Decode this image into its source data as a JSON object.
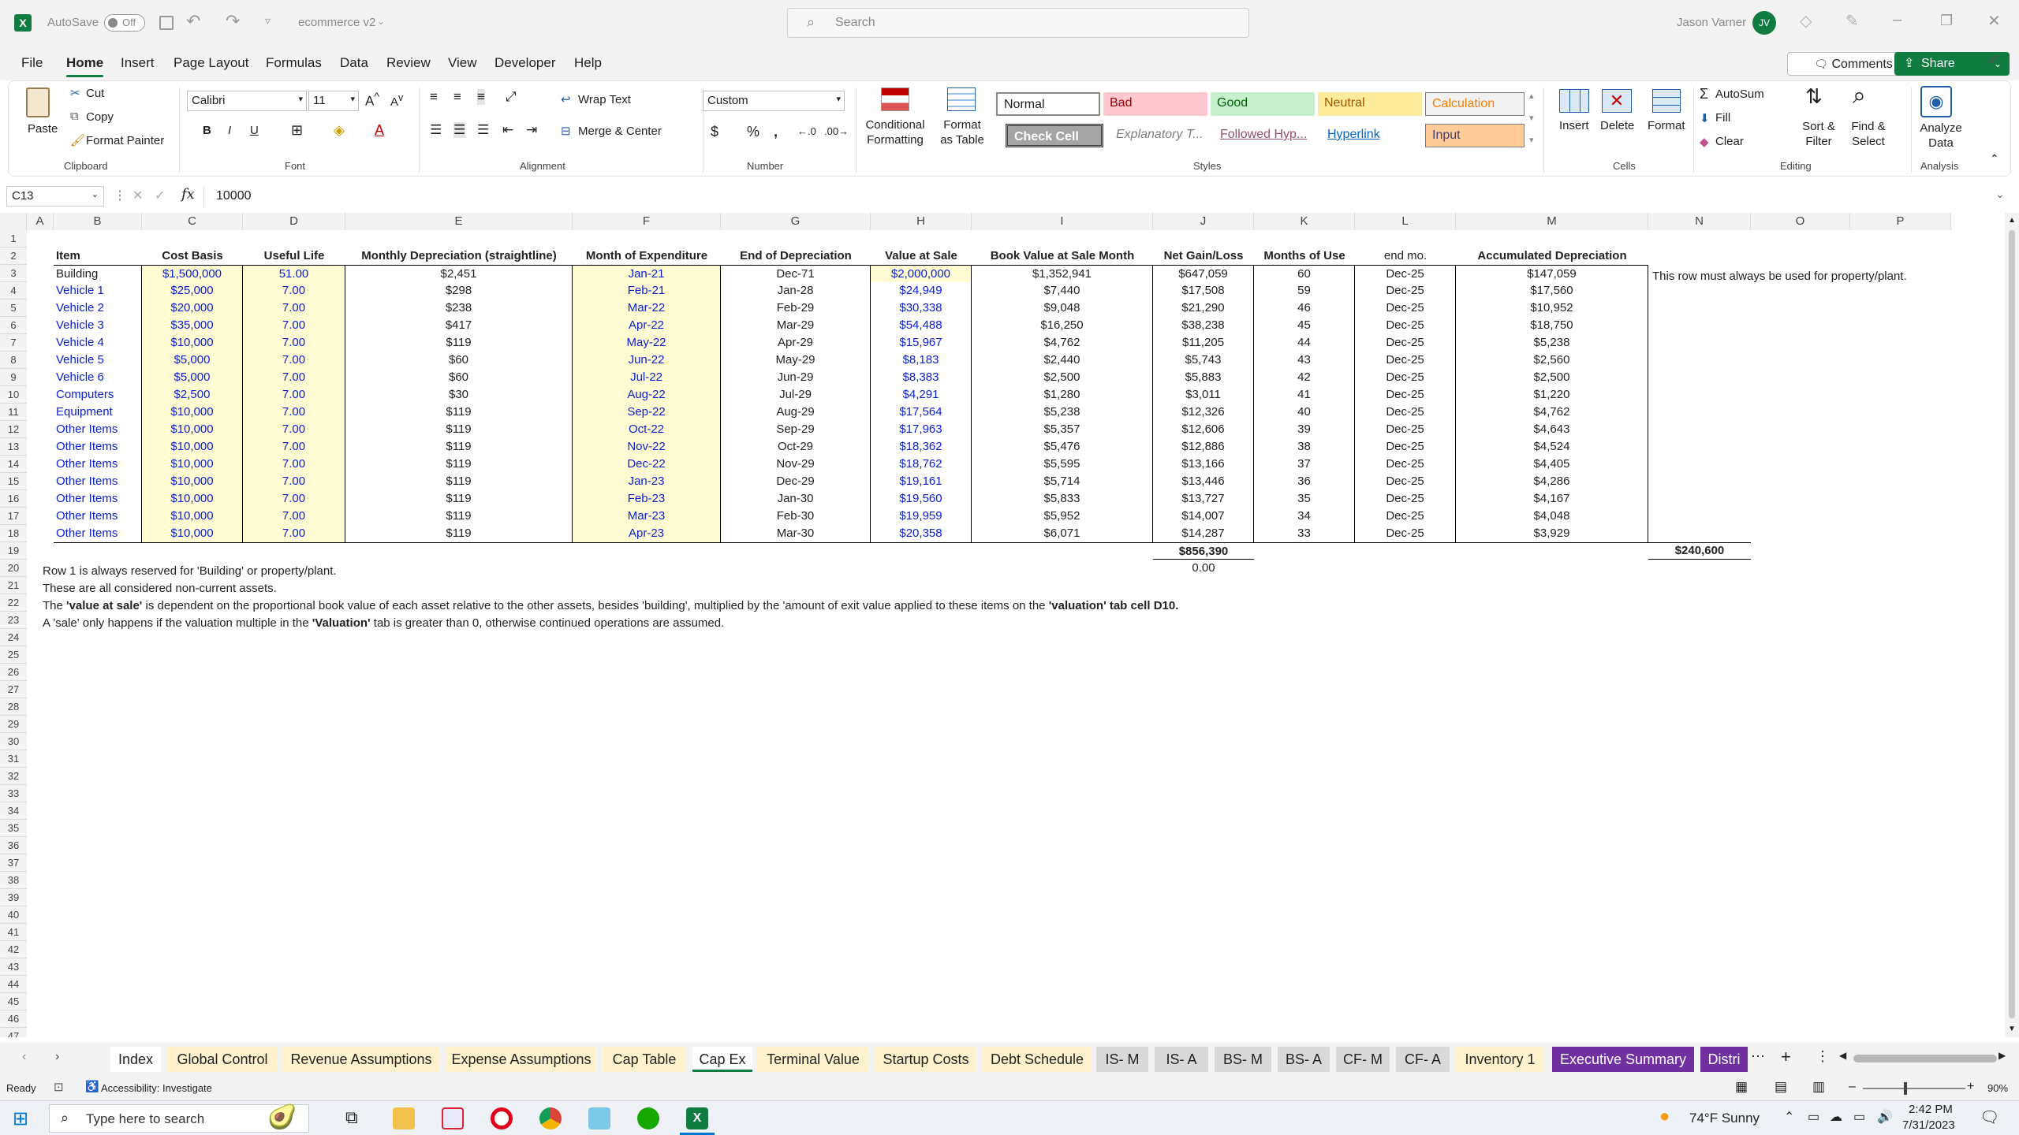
{
  "titlebar": {
    "autosave": "AutoSave",
    "autosave_state": "Off",
    "filename": "ecommerce v2",
    "search_placeholder": "Search",
    "user": "Jason Varner",
    "avatar_initials": "JV"
  },
  "menu": {
    "items": [
      "File",
      "Home",
      "Insert",
      "Page Layout",
      "Formulas",
      "Data",
      "Review",
      "View",
      "Developer",
      "Help"
    ],
    "comments": "Comments",
    "share": "Share"
  },
  "ribbon": {
    "clipboard": {
      "paste": "Paste",
      "cut": "Cut",
      "copy": "Copy",
      "format_painter": "Format Painter",
      "label": "Clipboard"
    },
    "font": {
      "name": "Calibri",
      "size": "11",
      "label": "Font"
    },
    "alignment": {
      "wrap": "Wrap Text",
      "merge": "Merge & Center",
      "label": "Alignment"
    },
    "number": {
      "format": "Custom",
      "label": "Number"
    },
    "styles": {
      "conditional": "Conditional Formatting",
      "format_table": "Format as Table",
      "label": "Styles",
      "cells": [
        "Normal",
        "Bad",
        "Good",
        "Neutral",
        "Calculation",
        "Check Cell",
        "Explanatory T...",
        "Followed Hyp...",
        "Hyperlink",
        "Input"
      ]
    },
    "cells": {
      "insert": "Insert",
      "delete": "Delete",
      "format": "Format",
      "label": "Cells"
    },
    "editing": {
      "autosum": "AutoSum",
      "fill": "Fill",
      "clear": "Clear",
      "sort": "Sort & Filter",
      "find": "Find & Select",
      "label": "Editing"
    },
    "analysis": {
      "analyze": "Analyze Data",
      "label": "Analysis"
    }
  },
  "formula_bar": {
    "name_box": "C13",
    "fx": "fx",
    "value": "10000"
  },
  "columns": [
    "A",
    "B",
    "C",
    "D",
    "E",
    "F",
    "G",
    "H",
    "I",
    "J",
    "K",
    "L",
    "M",
    "N",
    "O",
    "P"
  ],
  "headers": [
    "Item",
    "Cost Basis",
    "Useful Life",
    "Monthly Depreciation (straightline)",
    "Month of Expenditure",
    "End of Depreciation",
    "Value at Sale",
    "Book Value at Sale Month",
    "Net Gain/Loss",
    "Months of Use",
    "end mo.",
    "Accumulated Depreciation"
  ],
  "rows": [
    [
      "Building",
      "$1,500,000",
      "51.00",
      "$2,451",
      "Jan-21",
      "Dec-71",
      "$2,000,000",
      "$1,352,941",
      "$647,059",
      "60",
      "Dec-25",
      "$147,059"
    ],
    [
      "Vehicle 1",
      "$25,000",
      "7.00",
      "$298",
      "Feb-21",
      "Jan-28",
      "$24,949",
      "$7,440",
      "$17,508",
      "59",
      "Dec-25",
      "$17,560"
    ],
    [
      "Vehicle 2",
      "$20,000",
      "7.00",
      "$238",
      "Mar-22",
      "Feb-29",
      "$30,338",
      "$9,048",
      "$21,290",
      "46",
      "Dec-25",
      "$10,952"
    ],
    [
      "Vehicle 3",
      "$35,000",
      "7.00",
      "$417",
      "Apr-22",
      "Mar-29",
      "$54,488",
      "$16,250",
      "$38,238",
      "45",
      "Dec-25",
      "$18,750"
    ],
    [
      "Vehicle 4",
      "$10,000",
      "7.00",
      "$119",
      "May-22",
      "Apr-29",
      "$15,967",
      "$4,762",
      "$11,205",
      "44",
      "Dec-25",
      "$5,238"
    ],
    [
      "Vehicle 5",
      "$5,000",
      "7.00",
      "$60",
      "Jun-22",
      "May-29",
      "$8,183",
      "$2,440",
      "$5,743",
      "43",
      "Dec-25",
      "$2,560"
    ],
    [
      "Vehicle 6",
      "$5,000",
      "7.00",
      "$60",
      "Jul-22",
      "Jun-29",
      "$8,383",
      "$2,500",
      "$5,883",
      "42",
      "Dec-25",
      "$2,500"
    ],
    [
      "Computers",
      "$2,500",
      "7.00",
      "$30",
      "Aug-22",
      "Jul-29",
      "$4,291",
      "$1,280",
      "$3,011",
      "41",
      "Dec-25",
      "$1,220"
    ],
    [
      "Equipment",
      "$10,000",
      "7.00",
      "$119",
      "Sep-22",
      "Aug-29",
      "$17,564",
      "$5,238",
      "$12,326",
      "40",
      "Dec-25",
      "$4,762"
    ],
    [
      "Other Items",
      "$10,000",
      "7.00",
      "$119",
      "Oct-22",
      "Sep-29",
      "$17,963",
      "$5,357",
      "$12,606",
      "39",
      "Dec-25",
      "$4,643"
    ],
    [
      "Other Items",
      "$10,000",
      "7.00",
      "$119",
      "Nov-22",
      "Oct-29",
      "$18,362",
      "$5,476",
      "$12,886",
      "38",
      "Dec-25",
      "$4,524"
    ],
    [
      "Other Items",
      "$10,000",
      "7.00",
      "$119",
      "Dec-22",
      "Nov-29",
      "$18,762",
      "$5,595",
      "$13,166",
      "37",
      "Dec-25",
      "$4,405"
    ],
    [
      "Other Items",
      "$10,000",
      "7.00",
      "$119",
      "Jan-23",
      "Dec-29",
      "$19,161",
      "$5,714",
      "$13,446",
      "36",
      "Dec-25",
      "$4,286"
    ],
    [
      "Other Items",
      "$10,000",
      "7.00",
      "$119",
      "Feb-23",
      "Jan-30",
      "$19,560",
      "$5,833",
      "$13,727",
      "35",
      "Dec-25",
      "$4,167"
    ],
    [
      "Other Items",
      "$10,000",
      "7.00",
      "$119",
      "Mar-23",
      "Feb-30",
      "$19,959",
      "$5,952",
      "$14,007",
      "34",
      "Dec-25",
      "$4,048"
    ],
    [
      "Other Items",
      "$10,000",
      "7.00",
      "$119",
      "Apr-23",
      "Mar-30",
      "$20,358",
      "$6,071",
      "$14,287",
      "33",
      "Dec-25",
      "$3,929"
    ]
  ],
  "totals": {
    "net_gain": "$856,390",
    "accum": "$240,600",
    "check": "0.00"
  },
  "side_note": "This row must always be used for property/plant.",
  "notes": {
    "n20": "Row 1 is always reserved for 'Building' or property/plant.",
    "n21": "These are all considered non-current assets.",
    "n22a": "The ",
    "n22b": "'value at sale'",
    "n22c": " is dependent on the proportional book value of each asset relative to the other assets, besides 'building', multiplied by the 'amount of exit value applied to these items on the ",
    "n22d": "'valuation' tab cell D10.",
    "n23a": "A 'sale' only happens if the valuation multiple in the ",
    "n23b": "'Valuation'",
    "n23c": " tab is greater than 0, otherwise continued operations are assumed."
  },
  "sheets": [
    "Index",
    "Global Control",
    "Revenue Assumptions",
    "Expense Assumptions",
    "Cap Table",
    "Cap Ex",
    "Terminal Value",
    "Startup Costs",
    "Debt Schedule",
    "IS- M",
    "IS- A",
    "BS- M",
    "BS- A",
    "CF- M",
    "CF- A",
    "Inventory 1",
    "Executive Summary",
    "Distri"
  ],
  "status": {
    "ready": "Ready",
    "accessibility": "Accessibility: Investigate",
    "zoom": "90%"
  },
  "taskbar": {
    "search": "Type here to search",
    "weather": "74°F  Sunny",
    "time": "2:42 PM",
    "date": "7/31/2023"
  },
  "colors": {
    "excel_green": "#107c41",
    "input_yellow": "#fffcd4",
    "value_blue": "#0a1ed6",
    "purple_tab": "#7030a0"
  }
}
